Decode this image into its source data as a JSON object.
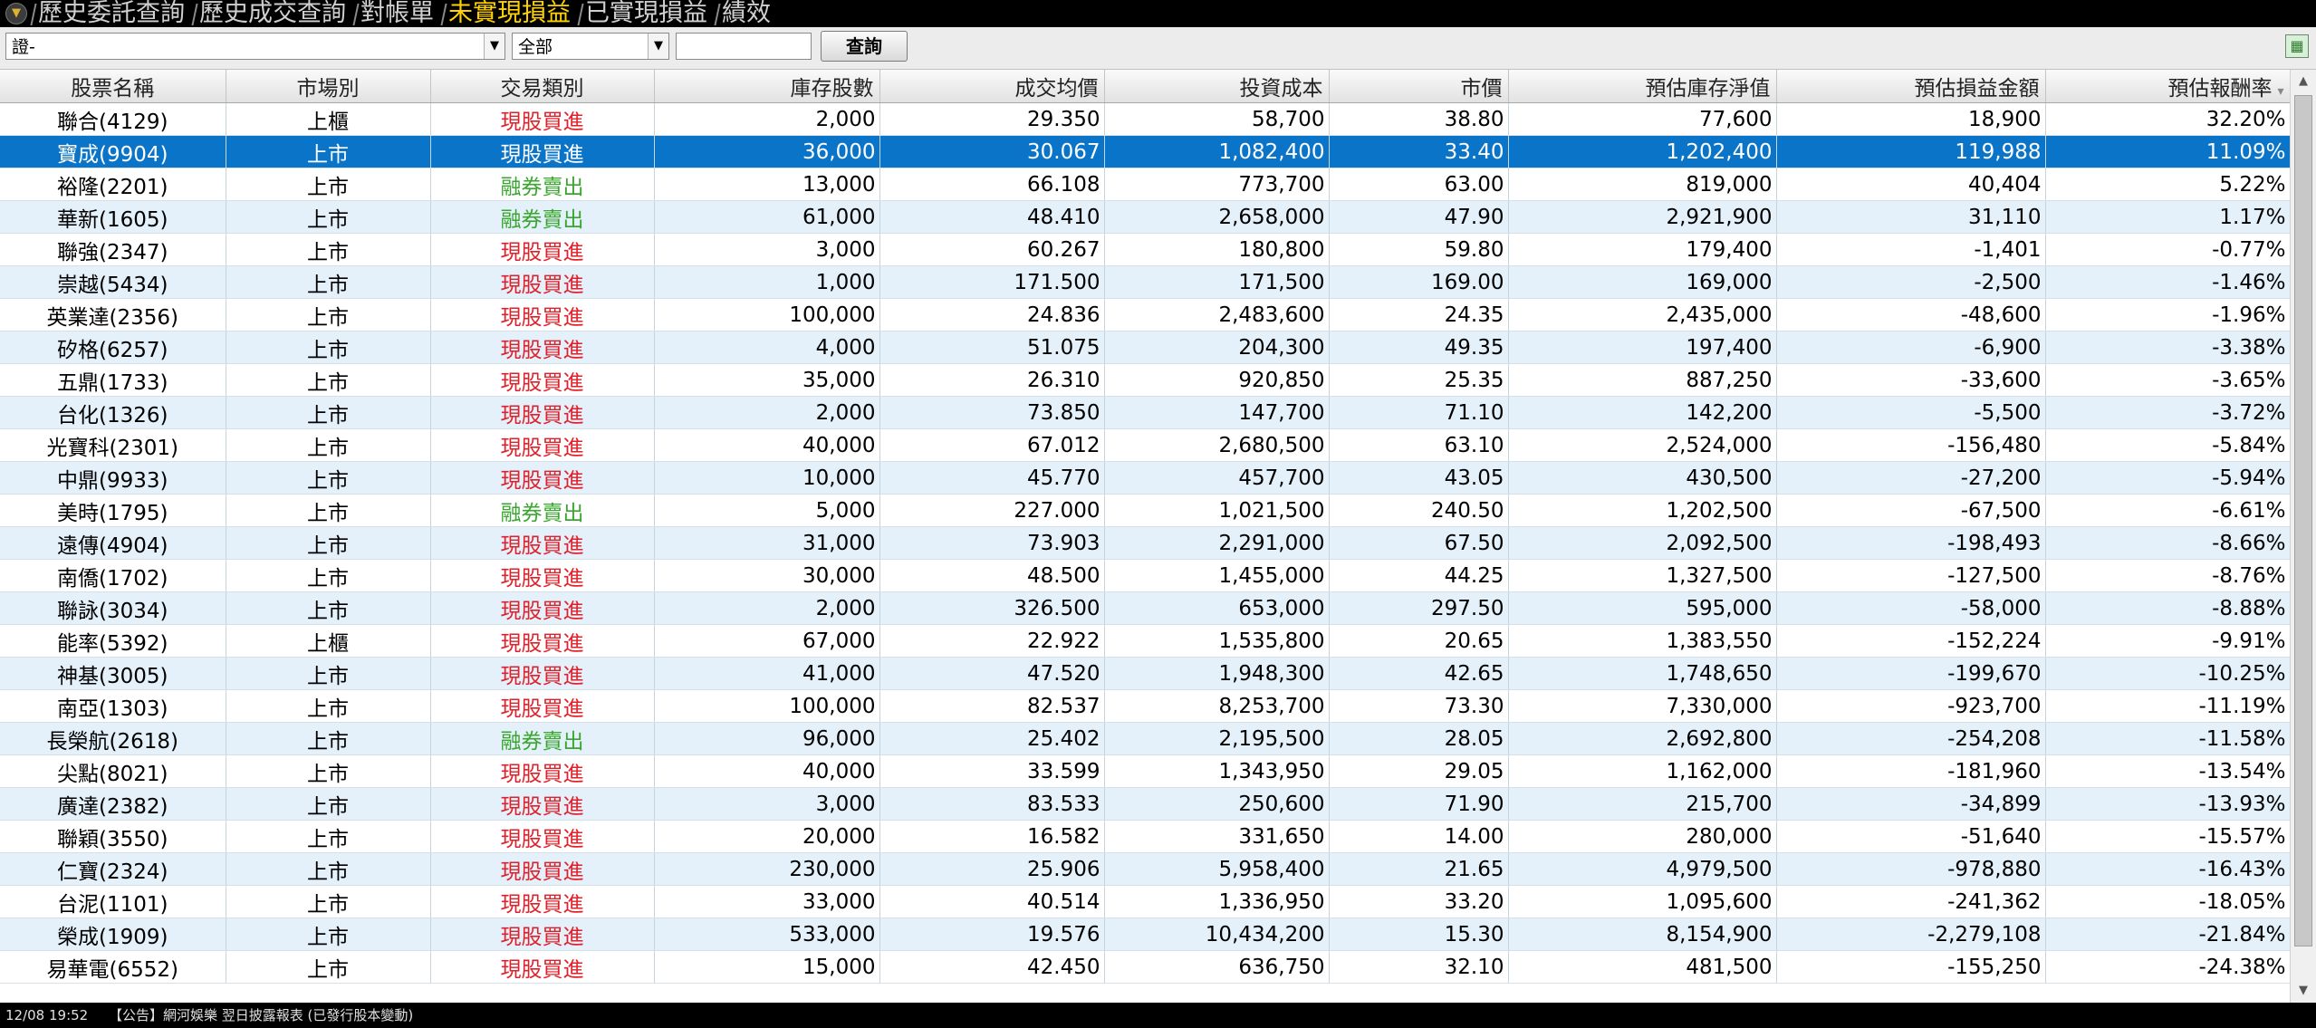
{
  "tabs": [
    {
      "label": "歷史委託查詢",
      "active": false
    },
    {
      "label": "歷史成交查詢",
      "active": false
    },
    {
      "label": "對帳單",
      "active": false
    },
    {
      "label": "未實現損益",
      "active": true
    },
    {
      "label": "已實現損益",
      "active": false
    },
    {
      "label": "績效",
      "active": false
    }
  ],
  "toolbar": {
    "stock_select_value": "證-",
    "market_select_value": "全部",
    "code_input_value": "",
    "query_button_label": "查詢"
  },
  "columns": [
    "股票名稱",
    "市場別",
    "交易類別",
    "庫存股數",
    "成交均價",
    "投資成本",
    "市價",
    "預估庫存淨值",
    "預估損益金額",
    "預估報酬率"
  ],
  "colors": {
    "buy": "#e0202a",
    "short_sell": "#3aa52f",
    "selected_row": "#0a74c9",
    "alt_row": "#e4f1fa"
  },
  "selected_row_index": 1,
  "rows": [
    [
      "聯合(4129)",
      "上櫃",
      "現股買進",
      "2,000",
      "29.350",
      "58,700",
      "38.80",
      "77,600",
      "18,900",
      "32.20%"
    ],
    [
      "寶成(9904)",
      "上市",
      "現股買進",
      "36,000",
      "30.067",
      "1,082,400",
      "33.40",
      "1,202,400",
      "119,988",
      "11.09%"
    ],
    [
      "裕隆(2201)",
      "上市",
      "融券賣出",
      "13,000",
      "66.108",
      "773,700",
      "63.00",
      "819,000",
      "40,404",
      "5.22%"
    ],
    [
      "華新(1605)",
      "上市",
      "融券賣出",
      "61,000",
      "48.410",
      "2,658,000",
      "47.90",
      "2,921,900",
      "31,110",
      "1.17%"
    ],
    [
      "聯強(2347)",
      "上市",
      "現股買進",
      "3,000",
      "60.267",
      "180,800",
      "59.80",
      "179,400",
      "-1,401",
      "-0.77%"
    ],
    [
      "崇越(5434)",
      "上市",
      "現股買進",
      "1,000",
      "171.500",
      "171,500",
      "169.00",
      "169,000",
      "-2,500",
      "-1.46%"
    ],
    [
      "英業達(2356)",
      "上市",
      "現股買進",
      "100,000",
      "24.836",
      "2,483,600",
      "24.35",
      "2,435,000",
      "-48,600",
      "-1.96%"
    ],
    [
      "矽格(6257)",
      "上市",
      "現股買進",
      "4,000",
      "51.075",
      "204,300",
      "49.35",
      "197,400",
      "-6,900",
      "-3.38%"
    ],
    [
      "五鼎(1733)",
      "上市",
      "現股買進",
      "35,000",
      "26.310",
      "920,850",
      "25.35",
      "887,250",
      "-33,600",
      "-3.65%"
    ],
    [
      "台化(1326)",
      "上市",
      "現股買進",
      "2,000",
      "73.850",
      "147,700",
      "71.10",
      "142,200",
      "-5,500",
      "-3.72%"
    ],
    [
      "光寶科(2301)",
      "上市",
      "現股買進",
      "40,000",
      "67.012",
      "2,680,500",
      "63.10",
      "2,524,000",
      "-156,480",
      "-5.84%"
    ],
    [
      "中鼎(9933)",
      "上市",
      "現股買進",
      "10,000",
      "45.770",
      "457,700",
      "43.05",
      "430,500",
      "-27,200",
      "-5.94%"
    ],
    [
      "美時(1795)",
      "上市",
      "融券賣出",
      "5,000",
      "227.000",
      "1,021,500",
      "240.50",
      "1,202,500",
      "-67,500",
      "-6.61%"
    ],
    [
      "遠傳(4904)",
      "上市",
      "現股買進",
      "31,000",
      "73.903",
      "2,291,000",
      "67.50",
      "2,092,500",
      "-198,493",
      "-8.66%"
    ],
    [
      "南僑(1702)",
      "上市",
      "現股買進",
      "30,000",
      "48.500",
      "1,455,000",
      "44.25",
      "1,327,500",
      "-127,500",
      "-8.76%"
    ],
    [
      "聯詠(3034)",
      "上市",
      "現股買進",
      "2,000",
      "326.500",
      "653,000",
      "297.50",
      "595,000",
      "-58,000",
      "-8.88%"
    ],
    [
      "能率(5392)",
      "上櫃",
      "現股買進",
      "67,000",
      "22.922",
      "1,535,800",
      "20.65",
      "1,383,550",
      "-152,224",
      "-9.91%"
    ],
    [
      "神基(3005)",
      "上市",
      "現股買進",
      "41,000",
      "47.520",
      "1,948,300",
      "42.65",
      "1,748,650",
      "-199,670",
      "-10.25%"
    ],
    [
      "南亞(1303)",
      "上市",
      "現股買進",
      "100,000",
      "82.537",
      "8,253,700",
      "73.30",
      "7,330,000",
      "-923,700",
      "-11.19%"
    ],
    [
      "長榮航(2618)",
      "上市",
      "融券賣出",
      "96,000",
      "25.402",
      "2,195,500",
      "28.05",
      "2,692,800",
      "-254,208",
      "-11.58%"
    ],
    [
      "尖點(8021)",
      "上市",
      "現股買進",
      "40,000",
      "33.599",
      "1,343,950",
      "29.05",
      "1,162,000",
      "-181,960",
      "-13.54%"
    ],
    [
      "廣達(2382)",
      "上市",
      "現股買進",
      "3,000",
      "83.533",
      "250,600",
      "71.90",
      "215,700",
      "-34,899",
      "-13.93%"
    ],
    [
      "聯穎(3550)",
      "上市",
      "現股買進",
      "20,000",
      "16.582",
      "331,650",
      "14.00",
      "280,000",
      "-51,640",
      "-15.57%"
    ],
    [
      "仁寶(2324)",
      "上市",
      "現股買進",
      "230,000",
      "25.906",
      "5,958,400",
      "21.65",
      "4,979,500",
      "-978,880",
      "-16.43%"
    ],
    [
      "台泥(1101)",
      "上市",
      "現股買進",
      "33,000",
      "40.514",
      "1,336,950",
      "33.20",
      "1,095,600",
      "-241,362",
      "-18.05%"
    ],
    [
      "榮成(1909)",
      "上市",
      "現股買進",
      "533,000",
      "19.576",
      "10,434,200",
      "15.30",
      "8,154,900",
      "-2,279,108",
      "-21.84%"
    ],
    [
      "易華電(6552)",
      "上市",
      "現股買進",
      "15,000",
      "42.450",
      "636,750",
      "32.10",
      "481,500",
      "-155,250",
      "-24.38%"
    ]
  ],
  "statusbar": {
    "time": "12/08 19:52",
    "message": "【公告】網河娛樂 翌日披露報表 (已發行股本變動)"
  }
}
